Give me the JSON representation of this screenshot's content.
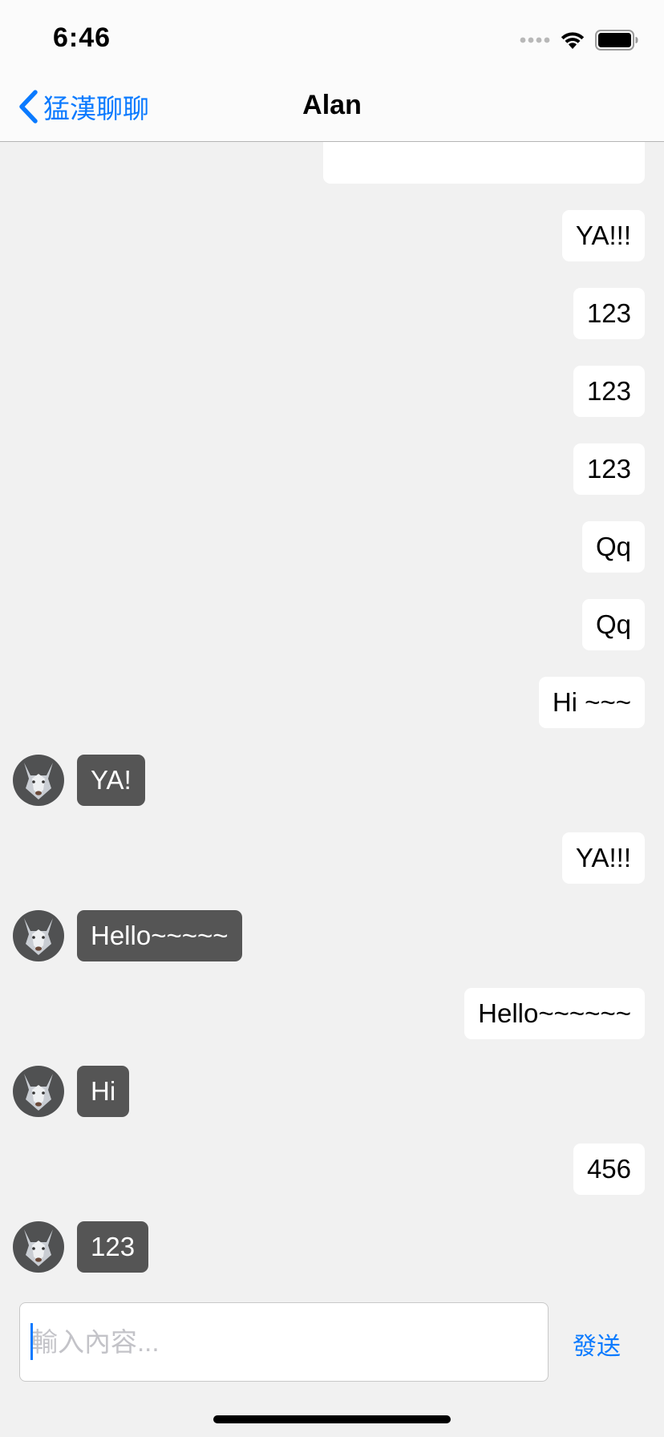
{
  "status_bar": {
    "time": "6:46"
  },
  "nav": {
    "back_label": "猛漢聊聊",
    "title": "Alan"
  },
  "colors": {
    "accent": "#0a7aff",
    "incoming_bubble": "#555555",
    "outgoing_bubble": "#ffffff",
    "background": "#f1f1f1"
  },
  "messages": [
    {
      "direction": "outgoing",
      "text": ""
    },
    {
      "direction": "outgoing",
      "text": "YA!!!"
    },
    {
      "direction": "outgoing",
      "text": "123"
    },
    {
      "direction": "outgoing",
      "text": "123"
    },
    {
      "direction": "outgoing",
      "text": "123"
    },
    {
      "direction": "outgoing",
      "text": "Qq"
    },
    {
      "direction": "outgoing",
      "text": "Qq"
    },
    {
      "direction": "outgoing",
      "text": "Hi ~~~"
    },
    {
      "direction": "incoming",
      "text": "YA!",
      "avatar": "wolf-avatar"
    },
    {
      "direction": "outgoing",
      "text": "YA!!!"
    },
    {
      "direction": "incoming",
      "text": "Hello~~~~~",
      "avatar": "wolf-avatar"
    },
    {
      "direction": "outgoing",
      "text": "Hello~~~~~~"
    },
    {
      "direction": "incoming",
      "text": "Hi",
      "avatar": "wolf-avatar"
    },
    {
      "direction": "outgoing",
      "text": "456"
    },
    {
      "direction": "incoming",
      "text": "123",
      "avatar": "wolf-avatar"
    }
  ],
  "composer": {
    "placeholder": "輸入內容...",
    "value": "",
    "send_label": "發送"
  }
}
